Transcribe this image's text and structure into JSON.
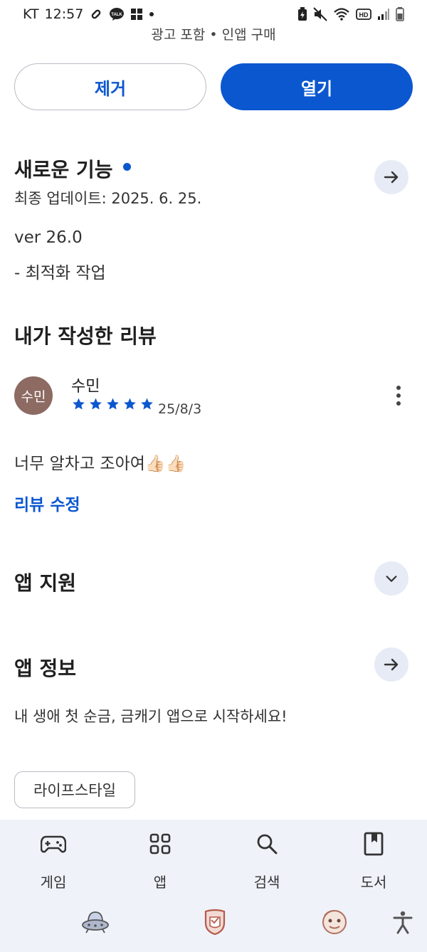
{
  "status_bar": {
    "carrier": "KT",
    "time": "12:57",
    "notif_icons": [
      "link-icon",
      "kakaotalk-icon",
      "grid-app-icon",
      "dot-icon"
    ],
    "kakao_label": "TALK",
    "right_icons": [
      "battery-saver-icon",
      "mute-icon",
      "wifi-icon",
      "hd-icon",
      "signal-icon",
      "battery-icon"
    ],
    "hd_label": "HD"
  },
  "app_header": {
    "sub_info": "광고 포함 • 인앱 구매"
  },
  "actions": {
    "remove_label": "제거",
    "open_label": "열기"
  },
  "whats_new": {
    "title": "새로운 기능",
    "updated": "최종 업데이트: 2025. 6. 25.",
    "version": "ver 26.0",
    "note": "- 최적화 작업"
  },
  "my_review": {
    "title": "내가 작성한 리뷰",
    "avatar_text": "수민",
    "reviewer_name": "수민",
    "rating": 5,
    "date": "25/8/3",
    "body": "너무 알차고 조아여👍🏻👍🏻",
    "edit_link": "리뷰 수정"
  },
  "app_support": {
    "title": "앱 지원"
  },
  "app_info": {
    "title": "앱 정보",
    "description": "내 생애 첫 순금, 금캐기 앱으로 시작하세요!",
    "category_chip": "라이프스타일"
  },
  "bottom_nav": {
    "items": [
      {
        "label": "게임",
        "icon": "gamepad-icon"
      },
      {
        "label": "앱",
        "icon": "apps-grid-icon"
      },
      {
        "label": "검색",
        "icon": "search-icon"
      },
      {
        "label": "도서",
        "icon": "book-icon"
      }
    ]
  },
  "system_bar": {
    "icons": [
      "ufo-game-icon",
      "shield-app-icon",
      "character-app-icon",
      "accessibility-icon"
    ]
  },
  "colors": {
    "accent": "#0b57d0",
    "avatar_bg": "#8d6a62",
    "nav_bg": "#eff2f9",
    "round_btn_bg": "#e6ebf5"
  }
}
